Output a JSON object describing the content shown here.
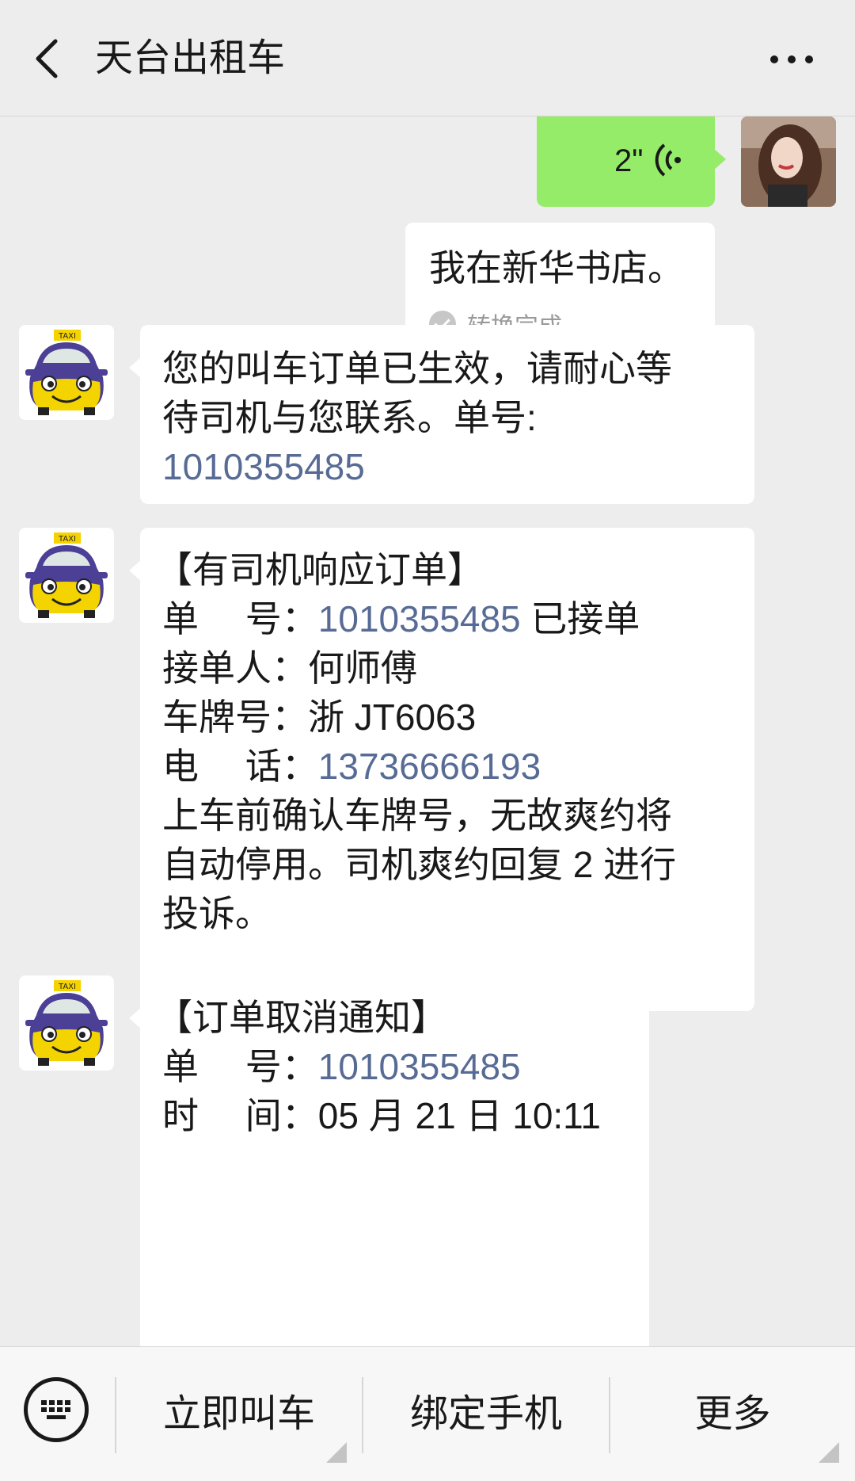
{
  "header": {
    "title": "天台出租车"
  },
  "voice": {
    "duration": "2\"",
    "transcript": "我在新华书店。",
    "status": "转换完成"
  },
  "messages": {
    "m1": {
      "line1": "您的叫车订单已生效，请耐心等",
      "line2": "待司机与您联系。单号:",
      "order_no": "1010355485"
    },
    "m2": {
      "title": "【有司机响应订单】",
      "order_label": "单　 号：",
      "order_no": "1010355485",
      "order_status": " 已接单",
      "driver_label": "接单人：",
      "driver": "何师傅",
      "plate_label": "车牌号：",
      "plate": "浙 JT6063",
      "phone_label": "电　 话：",
      "phone": "13736666193",
      "note1": "上车前确认车牌号，无故爽约将",
      "note2": "自动停用。司机爽约回复 2 进行",
      "note3": "投诉。"
    },
    "m3": {
      "title": "【订单取消通知】",
      "order_label": "单　 号：",
      "order_no": "1010355485",
      "time_label": "时　 间：",
      "time": "05 月 21 日 10:11"
    }
  },
  "menu": {
    "items": [
      "立即叫车",
      "绑定手机",
      "更多"
    ]
  },
  "colors": {
    "outgoing": "#95ec69",
    "link": "#576b95",
    "background": "#ededed"
  }
}
